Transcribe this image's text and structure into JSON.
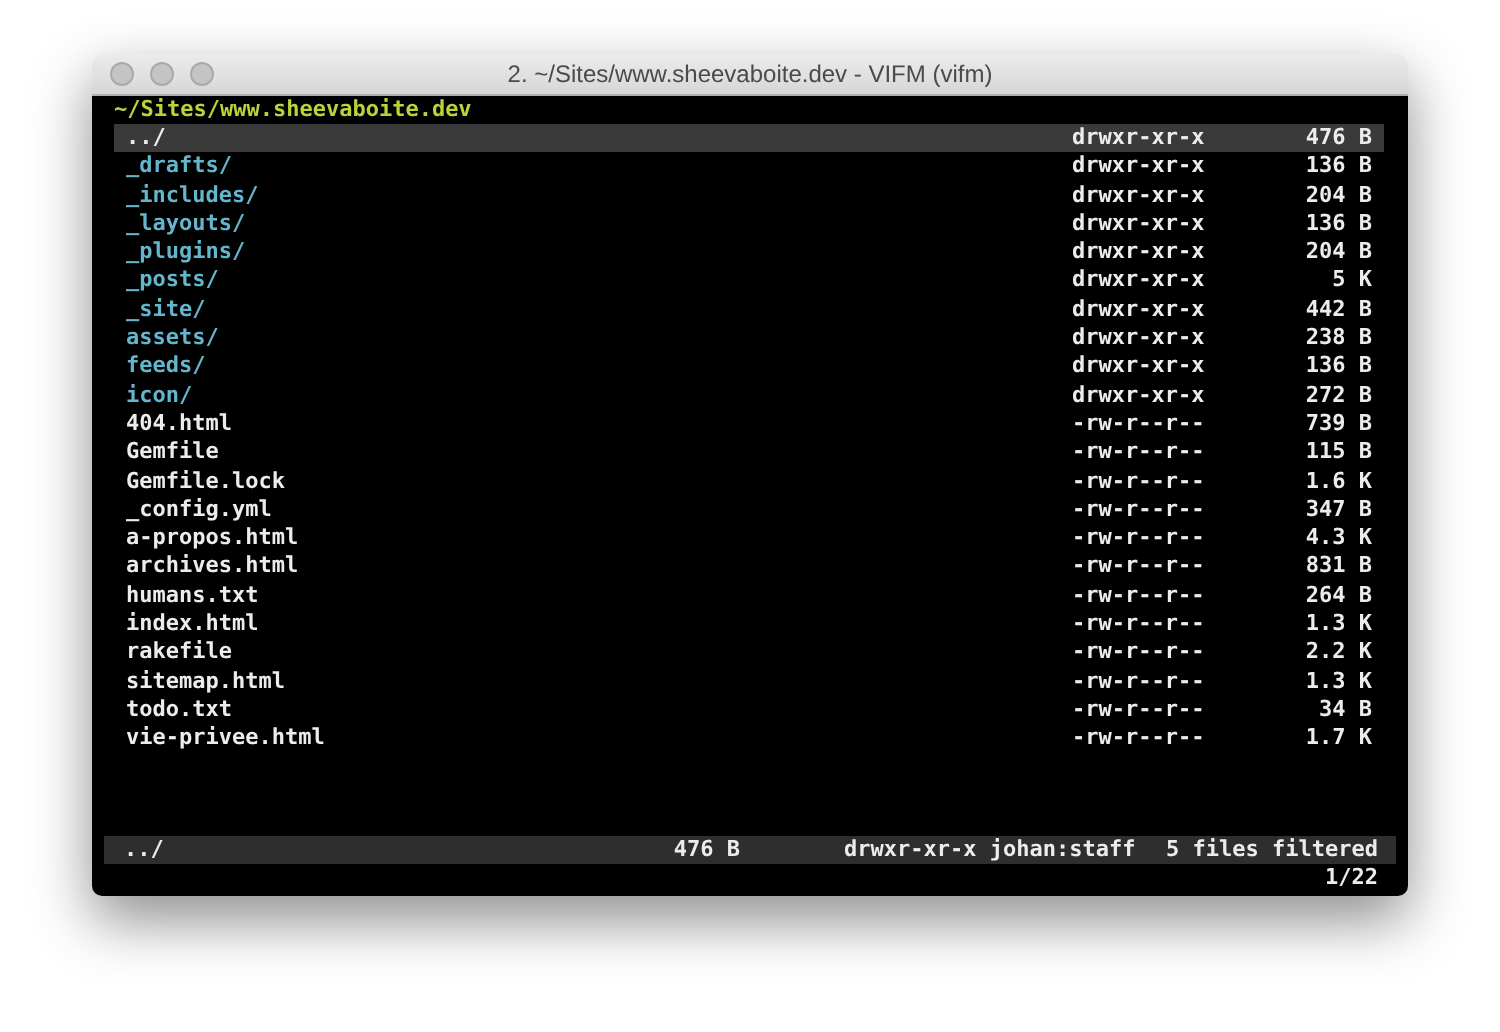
{
  "window": {
    "title": "2. ~/Sites/www.sheevaboite.dev - VIFM (vifm)"
  },
  "path": "~/Sites/www.sheevaboite.dev",
  "files": [
    {
      "name": "../",
      "kind": "dir",
      "perms": "drwxr-xr-x",
      "size": "476 B",
      "selected": true
    },
    {
      "name": "_drafts/",
      "kind": "dir",
      "perms": "drwxr-xr-x",
      "size": "136 B",
      "selected": false
    },
    {
      "name": "_includes/",
      "kind": "dir",
      "perms": "drwxr-xr-x",
      "size": "204 B",
      "selected": false
    },
    {
      "name": "_layouts/",
      "kind": "dir",
      "perms": "drwxr-xr-x",
      "size": "136 B",
      "selected": false
    },
    {
      "name": "_plugins/",
      "kind": "dir",
      "perms": "drwxr-xr-x",
      "size": "204 B",
      "selected": false
    },
    {
      "name": "_posts/",
      "kind": "dir",
      "perms": "drwxr-xr-x",
      "size": "5 K",
      "selected": false
    },
    {
      "name": "_site/",
      "kind": "dir",
      "perms": "drwxr-xr-x",
      "size": "442 B",
      "selected": false
    },
    {
      "name": "assets/",
      "kind": "dir",
      "perms": "drwxr-xr-x",
      "size": "238 B",
      "selected": false
    },
    {
      "name": "feeds/",
      "kind": "dir",
      "perms": "drwxr-xr-x",
      "size": "136 B",
      "selected": false
    },
    {
      "name": "icon/",
      "kind": "dir",
      "perms": "drwxr-xr-x",
      "size": "272 B",
      "selected": false
    },
    {
      "name": "404.html",
      "kind": "file",
      "perms": "-rw-r--r--",
      "size": "739 B",
      "selected": false
    },
    {
      "name": "Gemfile",
      "kind": "file",
      "perms": "-rw-r--r--",
      "size": "115 B",
      "selected": false
    },
    {
      "name": "Gemfile.lock",
      "kind": "file",
      "perms": "-rw-r--r--",
      "size": "1.6 K",
      "selected": false
    },
    {
      "name": "_config.yml",
      "kind": "file",
      "perms": "-rw-r--r--",
      "size": "347 B",
      "selected": false
    },
    {
      "name": "a-propos.html",
      "kind": "file",
      "perms": "-rw-r--r--",
      "size": "4.3 K",
      "selected": false
    },
    {
      "name": "archives.html",
      "kind": "file",
      "perms": "-rw-r--r--",
      "size": "831 B",
      "selected": false
    },
    {
      "name": "humans.txt",
      "kind": "file",
      "perms": "-rw-r--r--",
      "size": "264 B",
      "selected": false
    },
    {
      "name": "index.html",
      "kind": "file",
      "perms": "-rw-r--r--",
      "size": "1.3 K",
      "selected": false
    },
    {
      "name": "rakefile",
      "kind": "file",
      "perms": "-rw-r--r--",
      "size": "2.2 K",
      "selected": false
    },
    {
      "name": "sitemap.html",
      "kind": "file",
      "perms": "-rw-r--r--",
      "size": "1.3 K",
      "selected": false
    },
    {
      "name": "todo.txt",
      "kind": "file",
      "perms": "-rw-r--r--",
      "size": "34 B",
      "selected": false
    },
    {
      "name": "vie-privee.html",
      "kind": "file",
      "perms": "-rw-r--r--",
      "size": "1.7 K",
      "selected": false
    }
  ],
  "status_bar": {
    "name": "../",
    "size": "476 B",
    "info": "drwxr-xr-x johan:staff",
    "filter": "5 files filtered"
  },
  "position": "1/22"
}
